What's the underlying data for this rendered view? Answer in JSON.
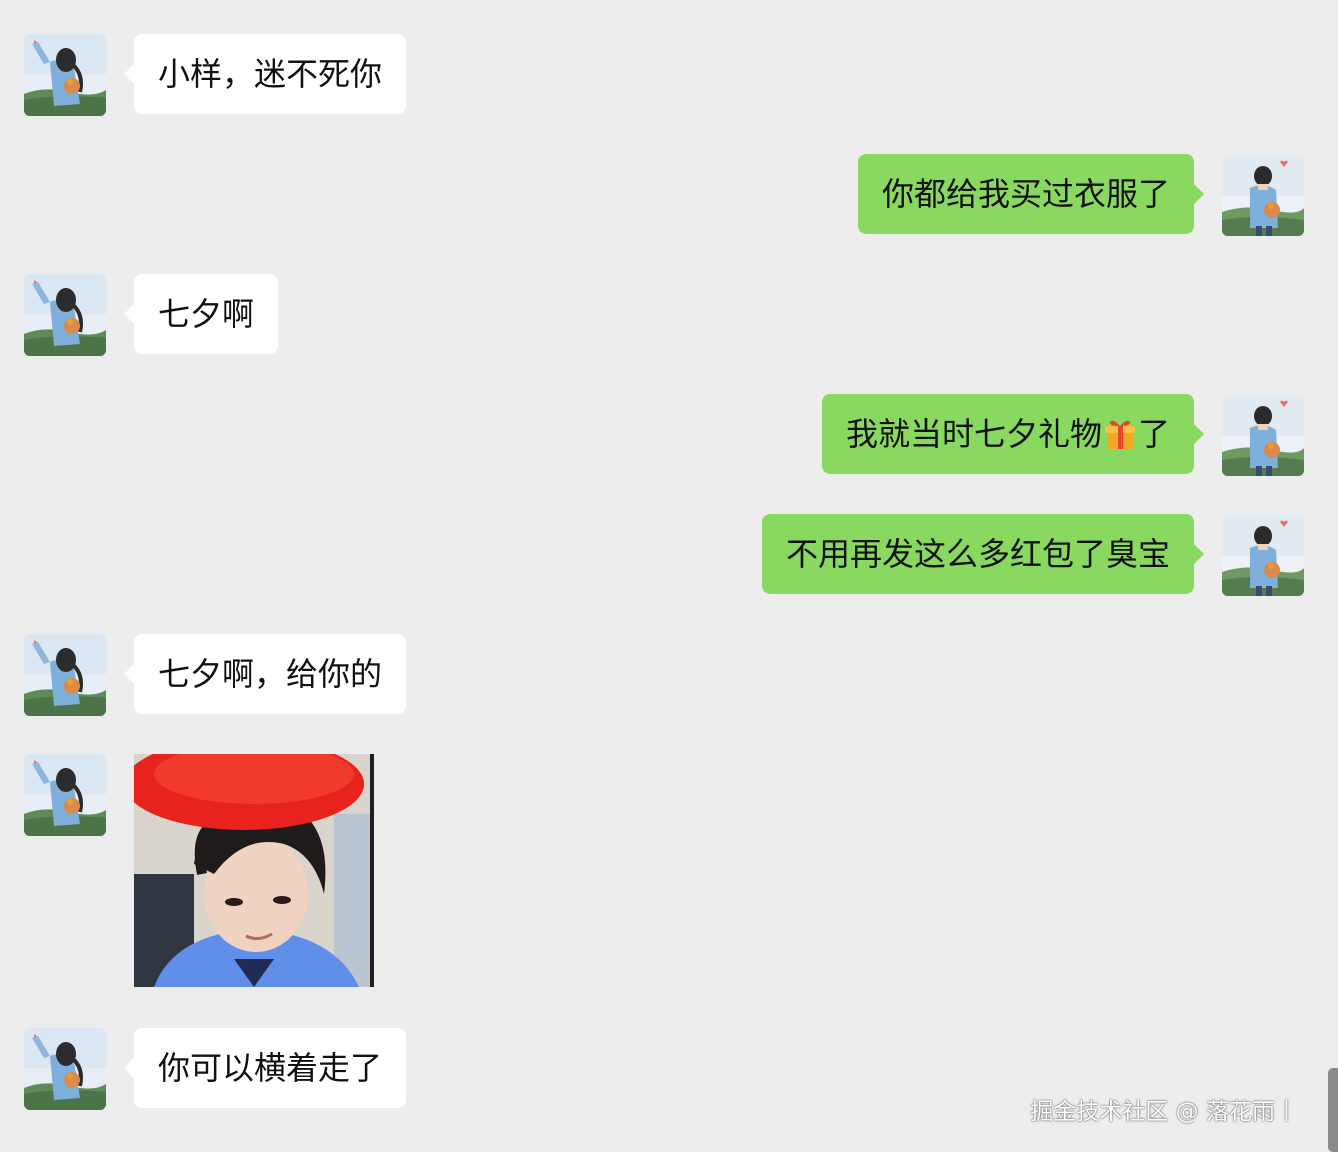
{
  "messages": [
    {
      "side": "left",
      "type": "text",
      "text": "小样，迷不死你"
    },
    {
      "side": "right",
      "type": "text",
      "text": "你都给我买过衣服了"
    },
    {
      "side": "left",
      "type": "text",
      "text": "七夕啊"
    },
    {
      "side": "right",
      "type": "text",
      "text_before": "我就当时七夕礼物",
      "emoji": "gift-icon",
      "text_after": "了"
    },
    {
      "side": "right",
      "type": "text",
      "text": "不用再发这么多红包了臭宝"
    },
    {
      "side": "left",
      "type": "text",
      "text": "七夕啊，给你的"
    },
    {
      "side": "left",
      "type": "image",
      "content": "photo of a person in a red beret and blue shirt"
    },
    {
      "side": "left",
      "type": "text",
      "text": "你可以横着走了"
    }
  ],
  "watermark": "掘金技术社区 @ 落花雨丨",
  "colors": {
    "background": "#ededed",
    "sent_bubble": "#89d961",
    "received_bubble": "#ffffff"
  }
}
